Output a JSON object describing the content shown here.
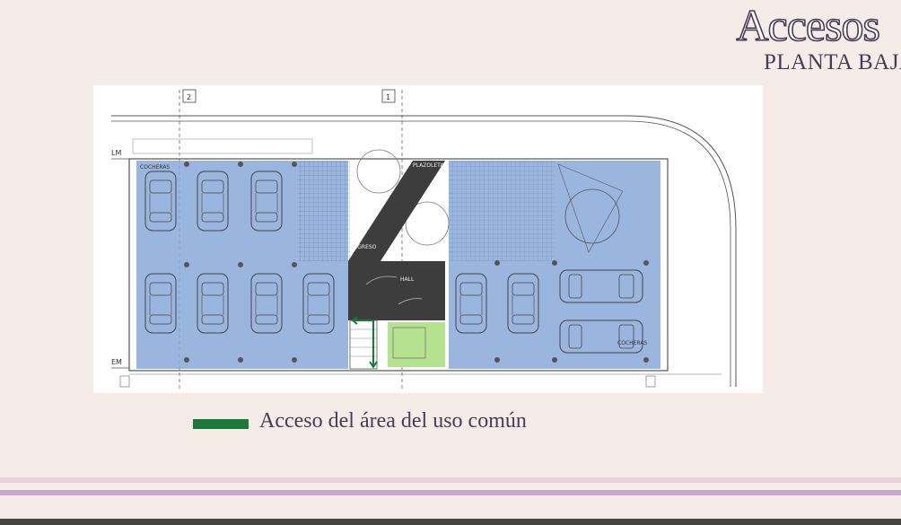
{
  "header": {
    "title": "Accesos",
    "subtitle": "PLANTA BAJA"
  },
  "plan": {
    "axis_labels": [
      "2",
      "1",
      "LM",
      "EM"
    ],
    "labels": [
      "COCHERAS",
      "PLAZOLETA",
      "INGRESO",
      "HALL",
      "COCHERAS"
    ],
    "zone_colors": {
      "parking": "#8aa9d8",
      "circulation": "#3d3d3d",
      "common_area": "#b5e28e",
      "access_arrow": "#1b7a3a"
    }
  },
  "legend": {
    "color": "#1b7a3a",
    "text": "Acceso del área del uso común"
  }
}
